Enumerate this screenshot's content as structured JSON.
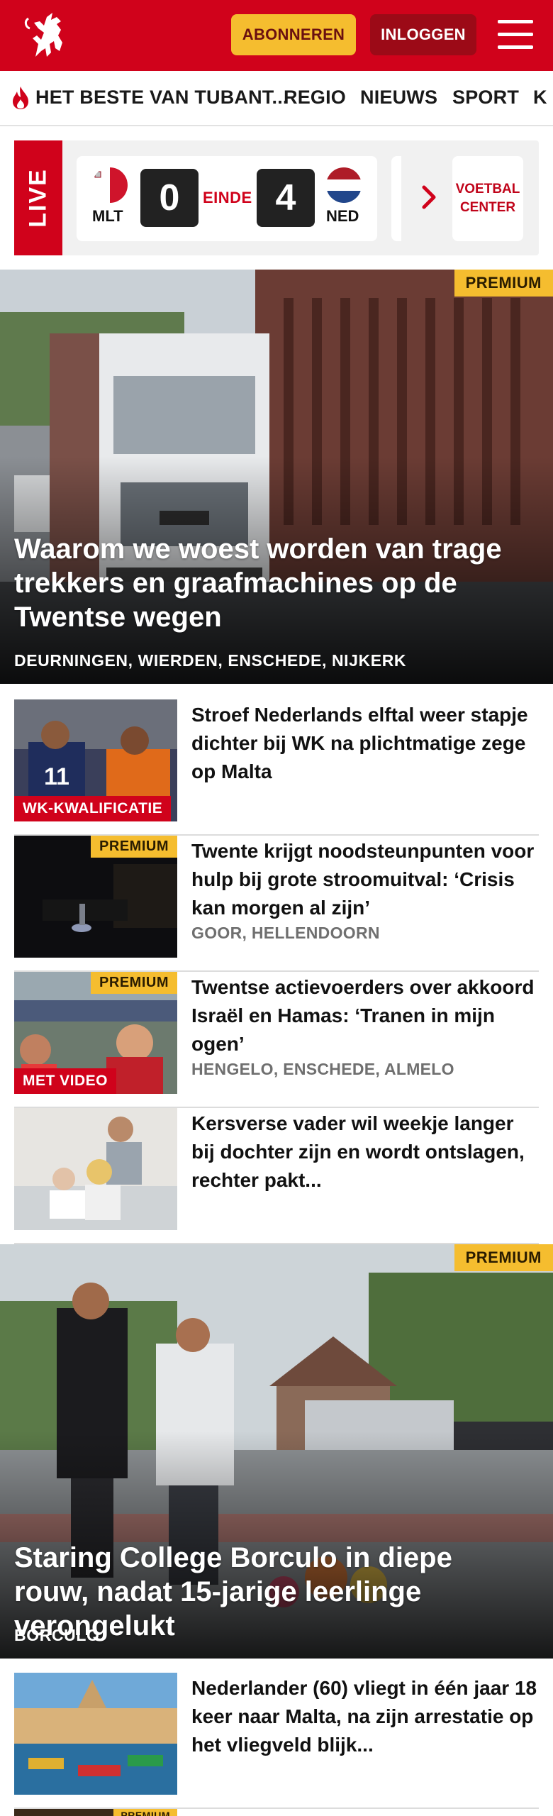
{
  "header": {
    "subscribe_label": "ABONNEREN",
    "login_label": "INLOGGEN",
    "brand_color": "#d0021b",
    "accent_color": "#f5bd2f"
  },
  "nav": {
    "items": [
      "HET BESTE VAN TUBANT...",
      "REGIO",
      "NIEUWS",
      "SPORT",
      "K"
    ]
  },
  "live": {
    "label": "LIVE",
    "match": {
      "home_code": "MLT",
      "home_score": "0",
      "status": "EINDE",
      "away_score": "4",
      "away_code": "NED"
    },
    "center_line1": "VOETBAL",
    "center_line2": "CENTER"
  },
  "hero1": {
    "badge": "PREMIUM",
    "title": "Waarom we woest worden van trage trekkers en graafmachines op de Twentse wegen",
    "location": "DEURNINGEN, WIERDEN, ENSCHEDE, NIJKERK"
  },
  "articles": [
    {
      "title": "Stroef Nederlands elftal weer stapje dichter bij WK na plichtmatige zege op Malta",
      "tag": "WK-KWALIFICATIE",
      "badge": "",
      "location": ""
    },
    {
      "title": "Twente krijgt noodsteunpunten voor hulp bij grote stroomuitval: ‘Crisis kan morgen al zijn’",
      "tag": "",
      "badge": "PREMIUM",
      "location": "GOOR, HELLENDOORN"
    },
    {
      "title": "Twentse actievoerders over akkoord Israël en Hamas: ‘Tranen in mijn ogen’",
      "tag": "MET VIDEO",
      "badge": "PREMIUM",
      "location": "HENGELO, ENSCHEDE, ALMELO"
    },
    {
      "title": "Kersverse vader wil weekje langer bij dochter zijn en wordt ontslagen, rechter pakt...",
      "tag": "",
      "badge": "",
      "location": ""
    }
  ],
  "hero2": {
    "badge": "PREMIUM",
    "title": "Staring College Borculo in diepe rouw, nadat 15-jarige leerlinge verongelukt",
    "location": "BORCULO"
  },
  "article5": {
    "title": "Nederlander (60) vliegt in één jaar 18 keer naar Malta, na zijn arrestatie op het vliegveld blijk..."
  },
  "article6": {
    "badge": "PREMIUM"
  }
}
